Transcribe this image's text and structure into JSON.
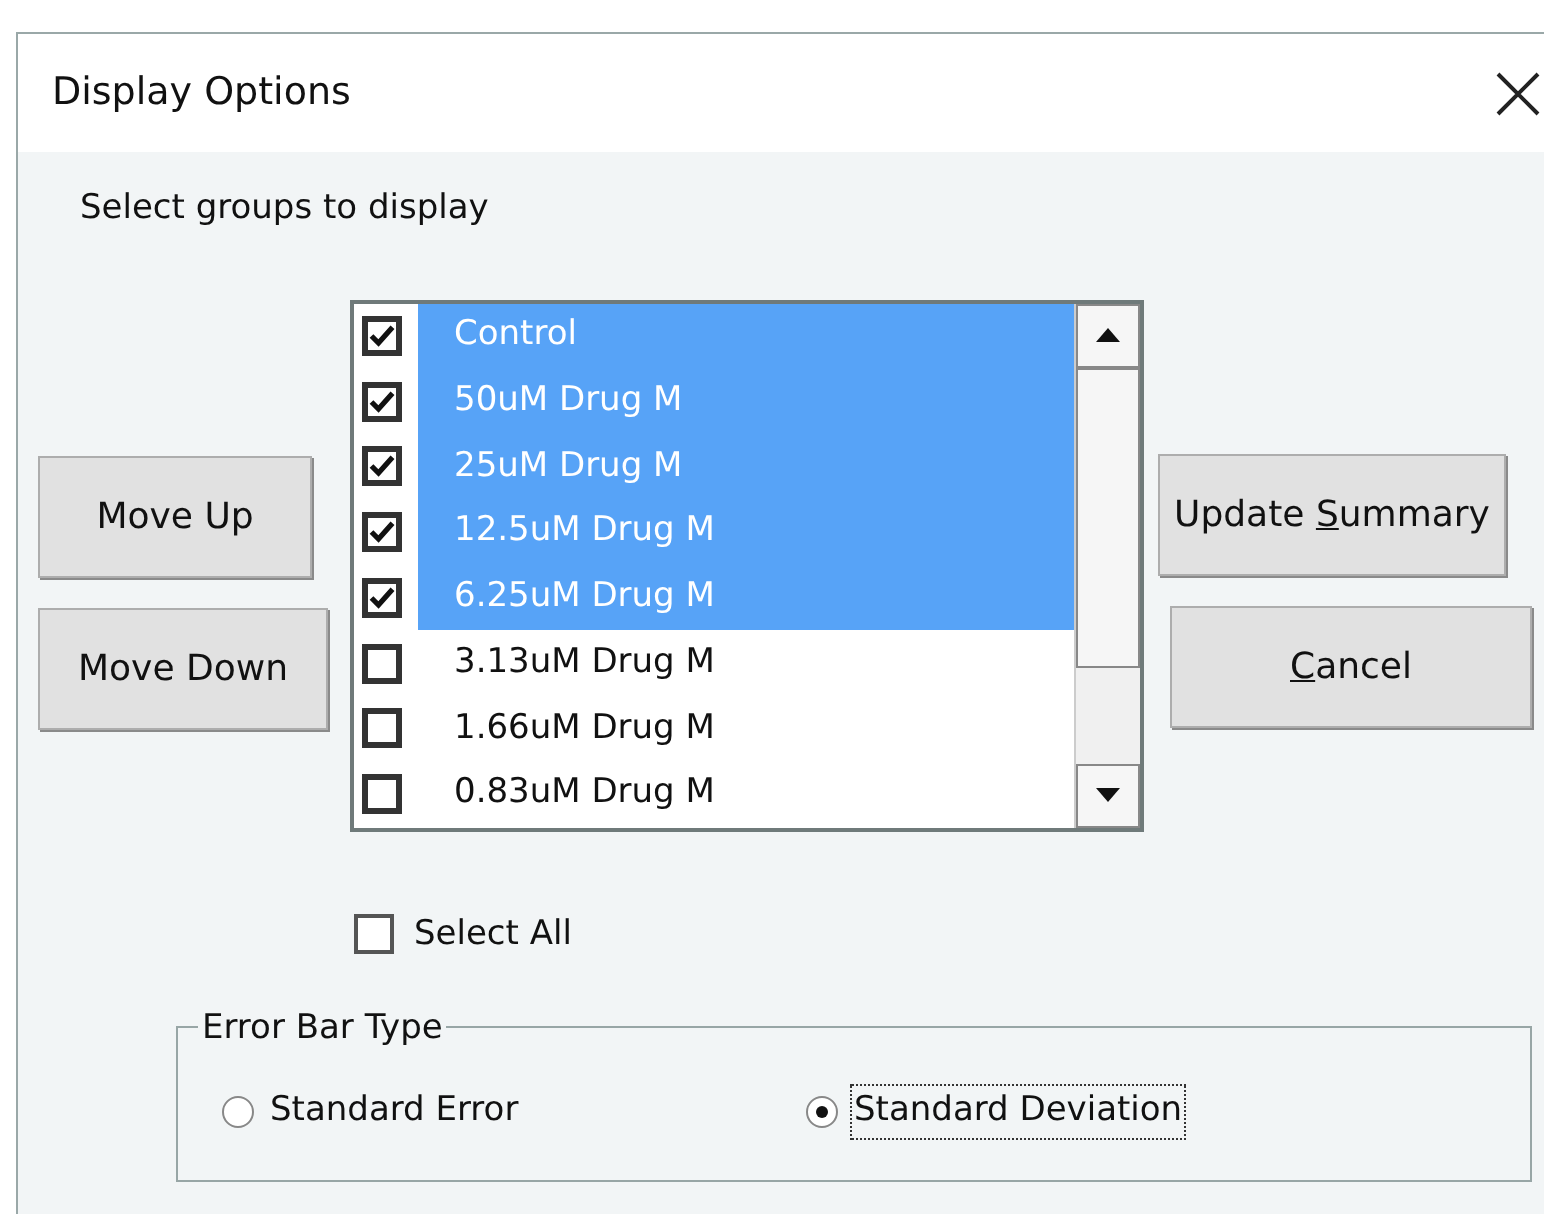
{
  "window": {
    "title": "Display Options"
  },
  "prompt": "Select groups to display",
  "left_buttons": [
    {
      "label": "Move Up"
    },
    {
      "label": "Move Down"
    }
  ],
  "groups": [
    {
      "label": "Control",
      "checked": true,
      "selected": true
    },
    {
      "label": "50uM Drug M",
      "checked": true,
      "selected": true
    },
    {
      "label": "25uM Drug M",
      "checked": true,
      "selected": true
    },
    {
      "label": "12.5uM Drug M",
      "checked": true,
      "selected": true
    },
    {
      "label": "6.25uM Drug M",
      "checked": true,
      "selected": true
    },
    {
      "label": "3.13uM Drug M",
      "checked": false,
      "selected": false
    },
    {
      "label": "1.66uM Drug M",
      "checked": false,
      "selected": false
    },
    {
      "label": "0.83uM Drug M",
      "checked": false,
      "selected": false
    }
  ],
  "right_buttons": [
    {
      "label": "Update ",
      "access_key": "S",
      "label_after": "ummary"
    },
    {
      "access_key": "C",
      "label_after": "ancel"
    }
  ],
  "select_all": {
    "label": "Select All",
    "checked": false
  },
  "error_bar_type": {
    "legend": "Error Bar Type",
    "options": [
      {
        "label": "Standard Error",
        "selected": false,
        "focused": false
      },
      {
        "label": "Standard Deviation",
        "selected": true,
        "focused": true
      }
    ]
  }
}
